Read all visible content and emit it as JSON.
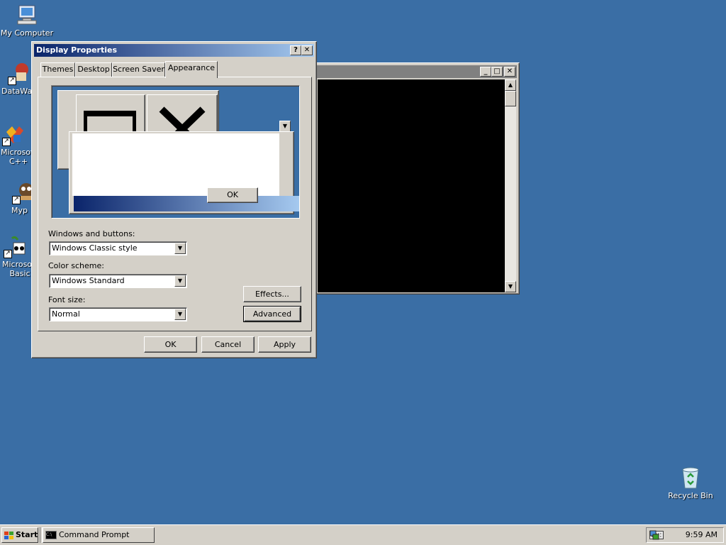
{
  "desktop": {
    "icons": [
      {
        "label": "My Computer",
        "icon": "computer-icon"
      },
      {
        "label": "DataWa",
        "icon": "datawarrior-icon"
      },
      {
        "label": "Microsoft C++",
        "icon": "visual-cpp-icon"
      },
      {
        "label": "Myp",
        "icon": "shortcut-icon"
      },
      {
        "label": "Microsoft Basic",
        "icon": "visual-basic-icon"
      },
      {
        "label": "Recycle Bin",
        "icon": "recycle-bin-icon"
      }
    ]
  },
  "console_window": {
    "minimize_glyph": "_",
    "maximize_glyph": "□",
    "close_glyph": "✕",
    "scroll_up_glyph": "▲",
    "scroll_down_glyph": "▼"
  },
  "dialog": {
    "title": "Display Properties",
    "help_glyph": "?",
    "close_glyph": "✕",
    "tabs": [
      "Themes",
      "Desktop",
      "Screen Saver",
      "Appearance"
    ],
    "active_tab": "Appearance",
    "preview": {
      "ok_label": "OK",
      "dropdown_glyph": "▼"
    },
    "windows_buttons_label": "Windows and buttons:",
    "windows_buttons_value": "Windows Classic style",
    "color_scheme_label": "Color scheme:",
    "color_scheme_value": "Windows Standard",
    "font_size_label": "Font size:",
    "font_size_value": "Normal",
    "effects_label": "Effects...",
    "advanced_label": "Advanced",
    "ok_label": "OK",
    "cancel_label": "Cancel",
    "apply_label": "Apply",
    "combo_arrow_glyph": "▼"
  },
  "taskbar": {
    "start_label": "Start",
    "tasks": [
      {
        "label": "Command Prompt",
        "icon": "command-prompt-icon"
      }
    ],
    "clock": "9:59 AM"
  },
  "colors": {
    "desktop": "#3a6ea5",
    "active_title_start": "#0a246a",
    "active_title_end": "#a6caf0",
    "inactive_title": "#808080",
    "face": "#d4d0c8"
  }
}
